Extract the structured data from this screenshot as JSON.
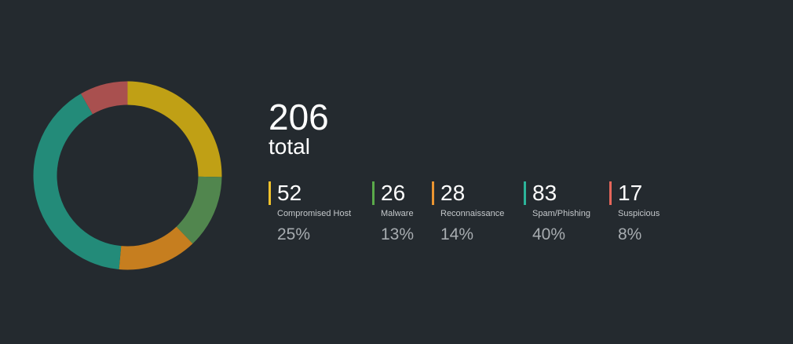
{
  "summary": {
    "total_value": "206",
    "total_label": "total"
  },
  "chart_data": {
    "type": "pie",
    "title": "",
    "total": 206,
    "categories": [
      "Compromised Host",
      "Malware",
      "Reconnaissance",
      "Spam/Phishing",
      "Suspicious"
    ],
    "values": [
      52,
      26,
      28,
      83,
      17
    ],
    "percentages": [
      "25%",
      "13%",
      "14%",
      "40%",
      "8%"
    ],
    "colors": [
      "#c0a015",
      "#51864e",
      "#c67e1f",
      "#238b79",
      "#a9504f"
    ],
    "legend_colors": [
      "#f0c22c",
      "#5aaa4a",
      "#eb9531",
      "#2cb49a",
      "#e5665a"
    ],
    "style": "donut"
  },
  "stats": [
    {
      "count": "52",
      "name": "Compromised Host",
      "pct": "25%"
    },
    {
      "count": "26",
      "name": "Malware",
      "pct": "13%"
    },
    {
      "count": "28",
      "name": "Reconnaissance",
      "pct": "14%"
    },
    {
      "count": "83",
      "name": "Spam/Phishing",
      "pct": "40%"
    },
    {
      "count": "17",
      "name": "Suspicious",
      "pct": "8%"
    }
  ]
}
